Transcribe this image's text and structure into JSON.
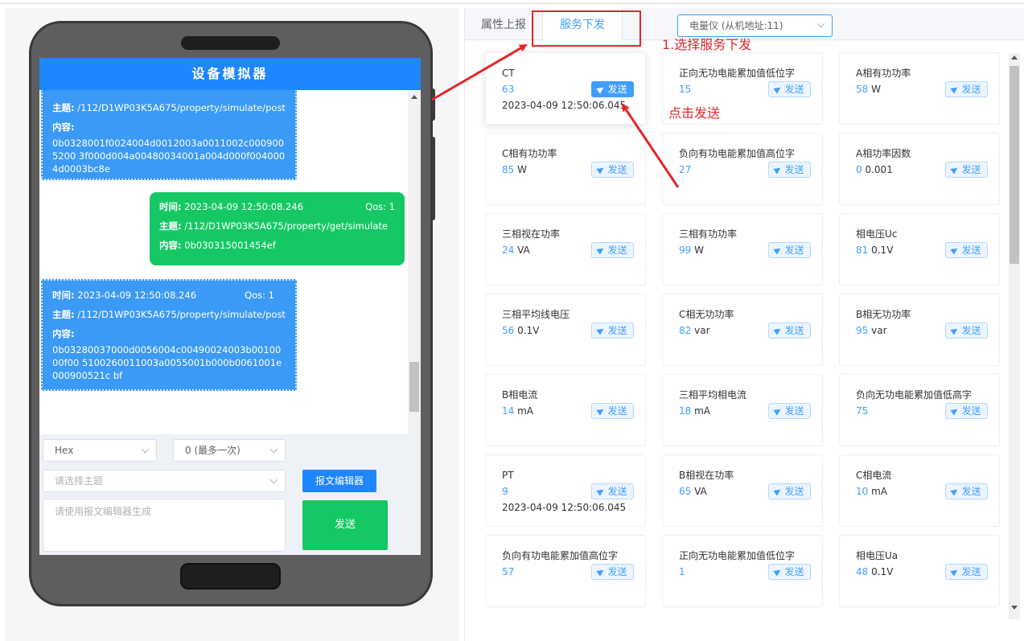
{
  "simulator": {
    "title": "设备模拟器",
    "messages": [
      {
        "type": "report",
        "topic_label": "主题:",
        "topic": "/112/D1WP03K5A675/property/simulate/post",
        "content_label": "内容:",
        "content": "0b0328001f0024004d0012003a0011002c0009005200 3f000d004a00480034001a004d000f0040004d0003bc8e"
      },
      {
        "type": "service",
        "time_label": "时间:",
        "time": "2023-04-09 12:50:08.246",
        "qos": "Qos: 1",
        "topic_label": "主题:",
        "topic": "/112/D1WP03K5A675/property/get/simulate",
        "content_label": "内容:",
        "content": "0b030315001454ef"
      },
      {
        "type": "report",
        "time_label": "时间:",
        "time": "2023-04-09 12:50:08.246",
        "qos": "Qos: 1",
        "topic_label": "主题:",
        "topic": "/112/D1WP03K5A675/property/simulate/post",
        "content_label": "内容:",
        "content": "0b03280037000d0056004c00490024003b0010000f00 5100260011003a0055001b000b0061001e000900521c bf"
      }
    ],
    "format_select": "Hex",
    "qos_select": "0 (最多一次)",
    "topic_placeholder": "请选择主题",
    "payload_placeholder": "请使用报文编辑器生成",
    "editor_button": "报文编辑器",
    "send_button": "发送"
  },
  "tabs": [
    {
      "label": "属性上报",
      "active": false
    },
    {
      "label": "服务下发",
      "active": true
    }
  ],
  "meter_select": "电量仪 (从机地址:11)",
  "send_label": "发送",
  "cards": [
    {
      "name": "CT",
      "value": "63",
      "unit": "",
      "time": "2023-04-09 12:50:06.045",
      "active": true
    },
    {
      "name": "正向无功电能累加值低位字",
      "value": "15",
      "unit": ""
    },
    {
      "name": "A相有功功率",
      "value": "58",
      "unit": "W"
    },
    {
      "name": "C相有功功率",
      "value": "85",
      "unit": "W"
    },
    {
      "name": "负向有功电能累加值高位字",
      "value": "27",
      "unit": ""
    },
    {
      "name": "A相功率因数",
      "value": "0",
      "unit": "0.001"
    },
    {
      "name": "三相视在功率",
      "value": "24",
      "unit": "VA"
    },
    {
      "name": "三相有功功率",
      "value": "99",
      "unit": "W"
    },
    {
      "name": "相电压Uc",
      "value": "81",
      "unit": "0.1V"
    },
    {
      "name": "三相平均线电压",
      "value": "56",
      "unit": "0.1V"
    },
    {
      "name": "C相无功功率",
      "value": "82",
      "unit": "var"
    },
    {
      "name": "B相无功功率",
      "value": "95",
      "unit": "var"
    },
    {
      "name": "B相电流",
      "value": "14",
      "unit": "mA"
    },
    {
      "name": "三相平均相电流",
      "value": "18",
      "unit": "mA"
    },
    {
      "name": "负向无功电能累加值低高字",
      "value": "75",
      "unit": ""
    },
    {
      "name": "PT",
      "value": "9",
      "unit": "",
      "time": "2023-04-09 12:50:06.045"
    },
    {
      "name": "B相视在功率",
      "value": "65",
      "unit": "VA"
    },
    {
      "name": "C相电流",
      "value": "10",
      "unit": "mA"
    },
    {
      "name": "负向有功电能累加值高位字",
      "value": "57",
      "unit": ""
    },
    {
      "name": "正向无功电能累加值低位字",
      "value": "1",
      "unit": ""
    },
    {
      "name": "相电压Ua",
      "value": "48",
      "unit": "0.1V"
    }
  ],
  "annotations": {
    "step1": "1.选择服务下发",
    "step2": "点击发送"
  },
  "colors": {
    "primary": "#1e86ff",
    "green": "#16c864",
    "annotation": "#e5252a"
  }
}
